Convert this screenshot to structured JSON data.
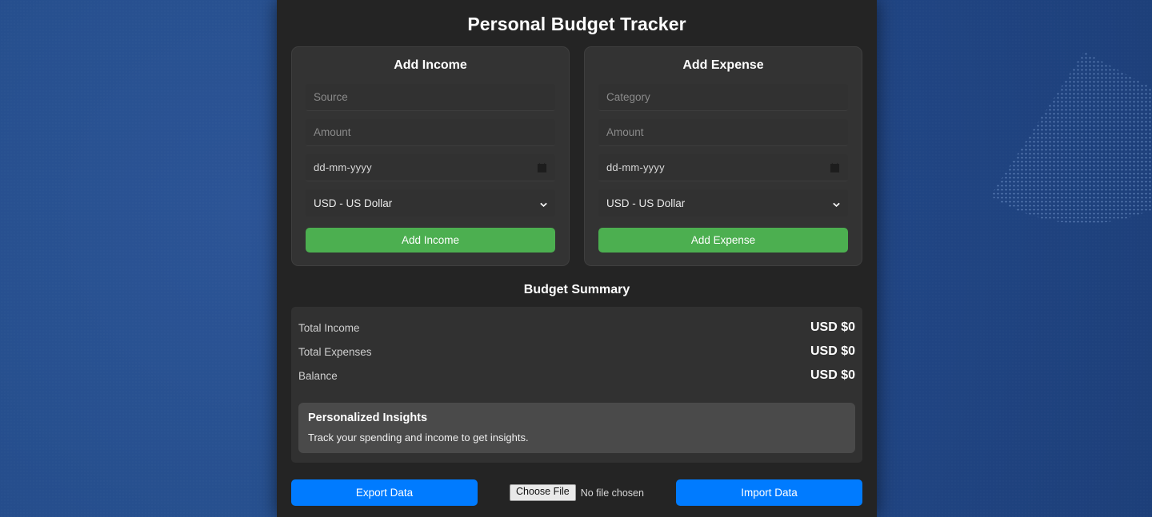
{
  "app": {
    "title": "Personal Budget Tracker"
  },
  "income_form": {
    "title": "Add Income",
    "source_placeholder": "Source",
    "source_value": "",
    "amount_placeholder": "Amount",
    "amount_value": "",
    "date_value": "dd-mm-yyyy",
    "date_icon": "calendar-icon",
    "currency_selected": "USD - US Dollar",
    "currency_options": [
      "USD - US Dollar"
    ],
    "currency_icon": "chevron-down-icon",
    "submit_label": "Add Income"
  },
  "expense_form": {
    "title": "Add Expense",
    "category_placeholder": "Category",
    "category_value": "",
    "amount_placeholder": "Amount",
    "amount_value": "",
    "date_value": "dd-mm-yyyy",
    "date_icon": "calendar-icon",
    "currency_selected": "USD - US Dollar",
    "currency_options": [
      "USD - US Dollar"
    ],
    "currency_icon": "chevron-down-icon",
    "submit_label": "Add Expense"
  },
  "summary": {
    "title": "Budget Summary",
    "rows": [
      {
        "label": "Total Income",
        "value": "USD $0"
      },
      {
        "label": "Total Expenses",
        "value": "USD $0"
      },
      {
        "label": "Balance",
        "value": "USD $0"
      }
    ],
    "insights": {
      "title": "Personalized Insights",
      "text": "Track your spending and income to get insights."
    }
  },
  "actions": {
    "export_label": "Export Data",
    "choose_file_label": "Choose File",
    "file_status": "No file chosen",
    "import_label": "Import Data"
  },
  "colors": {
    "accent_green": "#4caf50",
    "accent_blue": "#007bff",
    "app_background": "#242424",
    "card_background": "#333333",
    "panel_background": "#313131",
    "insights_background": "#4a4a4a",
    "page_background": "#27508f"
  }
}
